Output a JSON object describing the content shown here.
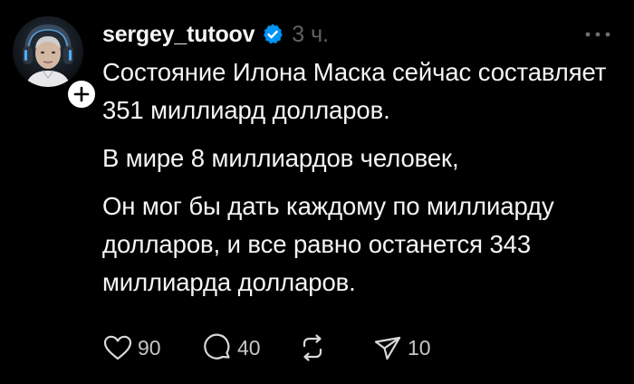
{
  "post": {
    "author": {
      "username": "sergey_tutoov",
      "verified": true,
      "avatar_icon": "avatar-photo",
      "follow_icon": "plus-icon"
    },
    "time": "3 ч.",
    "more_icon": "more-icon",
    "paragraphs": [
      "Состояние Илона Маска сейчас составляет 351 миллиард долларов.",
      "В мире 8 миллиардов человек,",
      "Он мог бы дать каждому по миллиарду долларов, и все равно останется 343 миллиарда долларов."
    ],
    "actions": {
      "likes": "90",
      "comments": "40",
      "reposts": "",
      "shares": "10"
    }
  },
  "colors": {
    "background": "#000000",
    "text": "#f3f5f7",
    "muted": "#616161",
    "action_count": "#c7c7c7",
    "verified": "#0095f6"
  }
}
